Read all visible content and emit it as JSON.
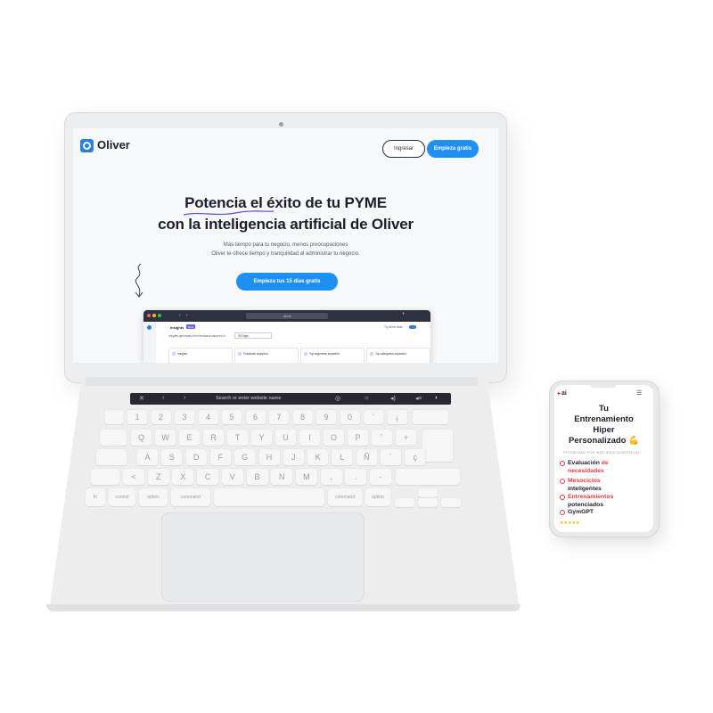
{
  "laptop": {
    "site": {
      "logo_text": "Oliver",
      "nav": {
        "login_label": "Ingresar",
        "cta_label": "Empieza gratis"
      },
      "hero": {
        "line1": "Potencia el éxito de tu PYME",
        "line2": "con la inteligencia artificial de Oliver",
        "sub1": "Más tiempo para tu negocio, menos preocupaciones",
        "sub2": "Oliver te ofrece tiempo y tranquilidad al administrar tu negocio.",
        "cta_label": "Empieza tus 15 días gratis"
      },
      "preview": {
        "url": "oliv.ai",
        "page_title": "Insights",
        "badge": "Beta",
        "filter_label": "Insights generated from feedback captured in",
        "filter_value": "30 Days",
        "demo_label": "Try demo data",
        "cards": [
          "Insights",
          "Feedback analyzed",
          "Top segments impacted",
          "Top categories impacted"
        ]
      }
    },
    "touchbar": {
      "search_text": "Search or enter website name"
    },
    "keyboard": {
      "row_numbers": [
        "1",
        "2",
        "3",
        "4",
        "5",
        "6",
        "7",
        "8",
        "9",
        "0",
        "'",
        "¡"
      ],
      "row_q": [
        "Q",
        "W",
        "E",
        "R",
        "T",
        "Y",
        "U",
        "I",
        "O",
        "P",
        "`",
        "+"
      ],
      "row_a": [
        "A",
        "S",
        "D",
        "F",
        "G",
        "H",
        "J",
        "K",
        "L",
        "Ñ",
        "´",
        "ç"
      ],
      "row_z": [
        "<",
        "Z",
        "X",
        "C",
        "V",
        "B",
        "N",
        "M",
        ",",
        ".",
        "-"
      ],
      "row_mod": [
        "fn",
        "control",
        "option",
        "command",
        "command",
        "option"
      ]
    }
  },
  "phone": {
    "logo_text": "ai",
    "title_lines": [
      "Tu",
      "Entrenamiento",
      "Hiper",
      "Personalizado 💪"
    ],
    "label": "POTENCIADO POR INTELIGENCIA ARTIFICIAL",
    "items": [
      {
        "a": "Evaluación ",
        "b": "de",
        "c": "necesidades"
      },
      {
        "a": "Mesociclos",
        "c": "inteligentes"
      },
      {
        "a": "Entrenamientos",
        "c": "potenciados"
      },
      {
        "a": "GymGPT"
      }
    ],
    "stars": "★★★★★"
  },
  "colors": {
    "accent": "#1e8ff3",
    "phone_accent": "#e03945",
    "logo": "#2a7fe0"
  }
}
